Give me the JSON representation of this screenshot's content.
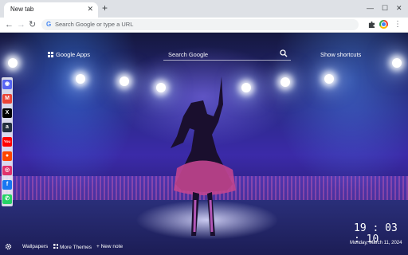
{
  "browser": {
    "tab_title": "New tab",
    "tab_close": "✕",
    "new_tab": "+",
    "win_min": "—",
    "win_max": "☐",
    "win_close": "✕",
    "back": "←",
    "forward": "→",
    "reload": "↻",
    "omnibox_g": "G",
    "omnibox_placeholder": "Search Google or type a URL",
    "menu": "⋮"
  },
  "page": {
    "apps_label": "Google Apps",
    "search_placeholder": "Search Google",
    "shortcuts_label": "Show shortcuts",
    "clock": "19 : 03 : 10",
    "date": "Monday, March 11, 2024",
    "bottom": {
      "wallpapers": "Wallpapers",
      "more_themes": "More Themes",
      "new_note": "+ New note"
    }
  },
  "sidebar": {
    "items": [
      {
        "name": "discord",
        "glyph": "◉",
        "color": "#5865f2"
      },
      {
        "name": "gmail",
        "glyph": "M",
        "color": "#ea4335"
      },
      {
        "name": "x",
        "glyph": "X",
        "color": "#000000"
      },
      {
        "name": "amazon",
        "glyph": "a",
        "color": "#232f3e"
      },
      {
        "name": "youtube",
        "glyph": "You",
        "color": "#ff0000"
      },
      {
        "name": "reddit",
        "glyph": "●",
        "color": "#ff4500"
      },
      {
        "name": "instagram",
        "glyph": "◎",
        "color": "#e1306c"
      },
      {
        "name": "facebook",
        "glyph": "f",
        "color": "#1877f2"
      },
      {
        "name": "whatsapp",
        "glyph": "✆",
        "color": "#25d366"
      }
    ]
  },
  "colors": {
    "chrome_bg": "#dee1e6",
    "accent": "#4285f4"
  }
}
